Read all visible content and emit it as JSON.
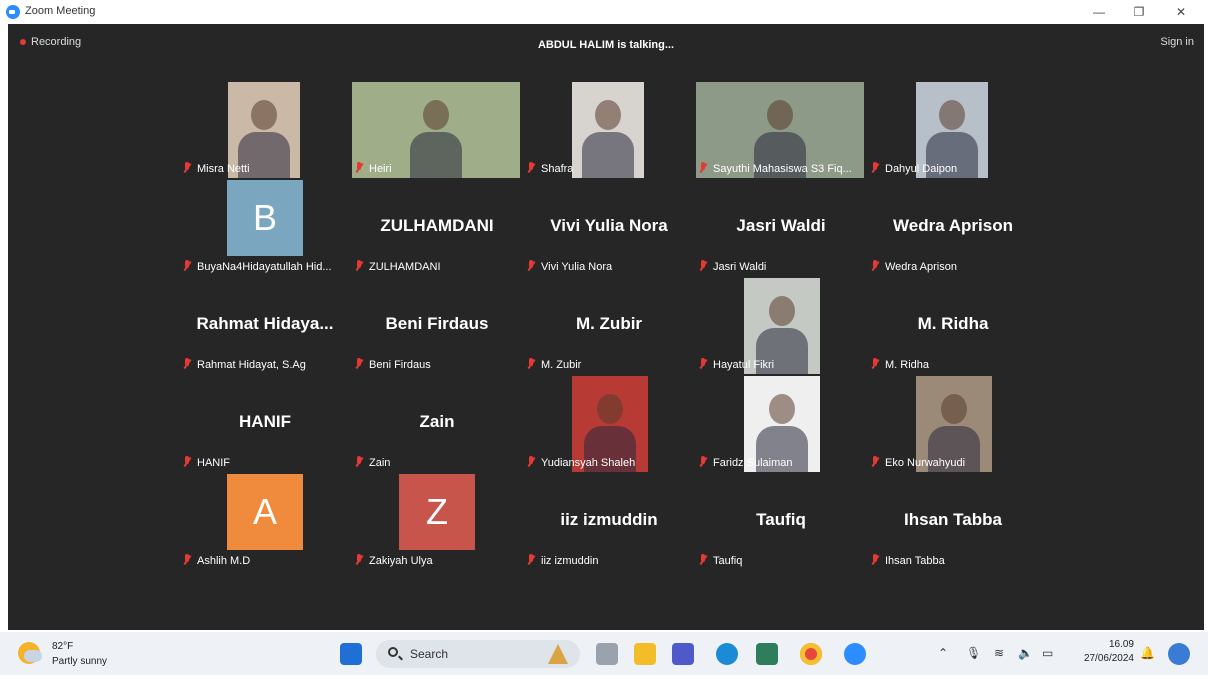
{
  "window": {
    "title": "Zoom Meeting",
    "minimize": "—",
    "restore": "❐",
    "close": "✕"
  },
  "meeting": {
    "recording": "Recording",
    "talking": "ABDUL HALIM is talking...",
    "sign_in": "Sign in"
  },
  "participants": [
    {
      "name": "Misra Netti",
      "display": "video",
      "video_bg": "#c9b9a6"
    },
    {
      "name": "Heiri",
      "display": "video",
      "video_bg": "#9fae88"
    },
    {
      "name": "Shafra",
      "display": "video",
      "video_bg": "#d7d3cf"
    },
    {
      "name": "Sayuthi Mahasiswa S3 Fiq...",
      "display": "video",
      "video_bg": "#8e9a88"
    },
    {
      "name": "Dahyul Daipon",
      "display": "video",
      "video_bg": "#b7c0c9"
    },
    {
      "name": "BuyaNa4Hidayatullah Hid...",
      "display": "avatar",
      "avatar_letter": "B",
      "avatar_color": "#7aa6bf"
    },
    {
      "name": "ZULHAMDANI",
      "display": "name",
      "big_name": "ZULHAMDANI"
    },
    {
      "name": "Vivi Yulia Nora",
      "display": "name",
      "big_name": "Vivi Yulia Nora"
    },
    {
      "name": "Jasri Waldi",
      "display": "name",
      "big_name": "Jasri Waldi"
    },
    {
      "name": "Wedra Aprison",
      "display": "name",
      "big_name": "Wedra Aprison"
    },
    {
      "name": "Rahmat Hidayat, S.Ag",
      "display": "name",
      "big_name": "Rahmat  Hidaya..."
    },
    {
      "name": "Beni Firdaus",
      "display": "name",
      "big_name": "Beni Firdaus"
    },
    {
      "name": "M. Zubir",
      "display": "name",
      "big_name": "M. Zubir"
    },
    {
      "name": "Hayatul Fikri",
      "display": "video",
      "video_bg": "#c5c9c4"
    },
    {
      "name": "M. Ridha",
      "display": "name",
      "big_name": "M. Ridha"
    },
    {
      "name": "HANIF",
      "display": "name",
      "big_name": "HANIF"
    },
    {
      "name": "Zain",
      "display": "name",
      "big_name": "Zain"
    },
    {
      "name": "Yudiansyah Shaleh",
      "display": "video",
      "video_bg": "#b73b34"
    },
    {
      "name": "Faridz Sulaiman",
      "display": "video",
      "video_bg": "#efefef"
    },
    {
      "name": "Eko Nurwahyudi",
      "display": "video",
      "video_bg": "#9c8a78"
    },
    {
      "name": "Ashlih M.D",
      "display": "avatar",
      "avatar_letter": "A",
      "avatar_color": "#f08a3c"
    },
    {
      "name": "Zakiyah Ulya",
      "display": "avatar",
      "avatar_letter": "Z",
      "avatar_color": "#c8554b"
    },
    {
      "name": "iiz izmuddin",
      "display": "name",
      "big_name": "iiz izmuddin"
    },
    {
      "name": "Taufiq",
      "display": "name",
      "big_name": "Taufiq"
    },
    {
      "name": "Ihsan Tabba",
      "display": "name",
      "big_name": "Ihsan Tabba"
    }
  ],
  "taskbar": {
    "weather": {
      "temp": "82°F",
      "condition": "Partly sunny"
    },
    "search_label": "Search",
    "pinned_icons": [
      "widgets-icon",
      "windows-start-icon",
      "file-explorer-icon",
      "teams-icon",
      "edge-icon",
      "store-icon",
      "chrome-icon",
      "zoom-icon"
    ],
    "clock": {
      "time": "16.09",
      "date": "27/06/2024"
    }
  },
  "colors": {
    "stage_bg": "#262626",
    "taskbar_bg": "#eef1f5",
    "mute_red": "#e53935"
  }
}
